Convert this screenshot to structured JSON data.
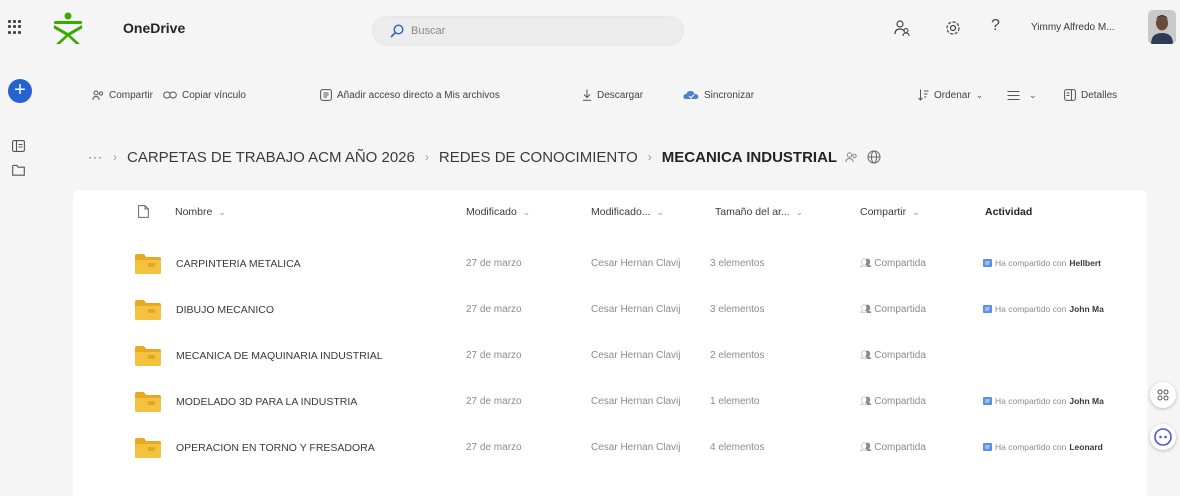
{
  "app": {
    "title": "OneDrive",
    "search_placeholder": "Buscar",
    "user_name": "Yimmy Alfredo M..."
  },
  "toolbar": {
    "share": "Compartir",
    "copy_link": "Copiar vínculo",
    "add_shortcut": "Añadir acceso directo a Mis archivos",
    "download": "Descargar",
    "sync": "Sincronizar",
    "sort": "Ordenar",
    "details": "Detalles"
  },
  "breadcrumb": {
    "ellipsis": "···",
    "items": [
      "CARPETAS DE TRABAJO ACM AÑO 2026",
      "REDES DE CONOCIMIENTO",
      "MECANICA INDUSTRIAL"
    ]
  },
  "table": {
    "columns": [
      "Nombre",
      "Modificado",
      "Modificado...",
      "Tamaño del ar...",
      "Compartir",
      "Actividad"
    ],
    "rows": [
      {
        "name": "CARPINTERIA METALICA",
        "modified": "27 de marzo",
        "modified_by": "Cesar Hernan Clavij",
        "size": "3 elementos",
        "sharing": "Compartida",
        "activity": "Ha compartido con",
        "activity_person": "Hellbert"
      },
      {
        "name": "DIBUJO MECANICO",
        "modified": "27 de marzo",
        "modified_by": "Cesar Hernan Clavij",
        "size": "3 elementos",
        "sharing": "Compartida",
        "activity": "Ha compartido con",
        "activity_person": "John Ma"
      },
      {
        "name": "MECANICA DE MAQUINARIA INDUSTRIAL",
        "modified": "27 de marzo",
        "modified_by": "Cesar Hernan Clavij",
        "size": "2 elementos",
        "sharing": "Compartida",
        "activity": "",
        "activity_person": ""
      },
      {
        "name": "MODELADO 3D PARA LA INDUSTRIA",
        "modified": "27 de marzo",
        "modified_by": "Cesar Hernan Clavij",
        "size": "1 elemento",
        "sharing": "Compartida",
        "activity": "Ha compartido con",
        "activity_person": "John Ma"
      },
      {
        "name": "OPERACION EN TORNO Y FRESADORA",
        "modified": "27 de marzo",
        "modified_by": "Cesar Hernan Clavij",
        "size": "4 elementos",
        "sharing": "Compartida",
        "activity": "Ha compartido con",
        "activity_person": "Leonard"
      }
    ]
  },
  "icons": {
    "app_launcher": "waffle-icon",
    "search": "search-icon",
    "people": "people-icon",
    "settings": "gear-icon",
    "help": "help-icon",
    "new": "plus-icon",
    "folder": "folder-icon"
  },
  "colors": {
    "accent": "#2564cf",
    "folder": "#f0b830",
    "logo_green": "#39a900"
  }
}
